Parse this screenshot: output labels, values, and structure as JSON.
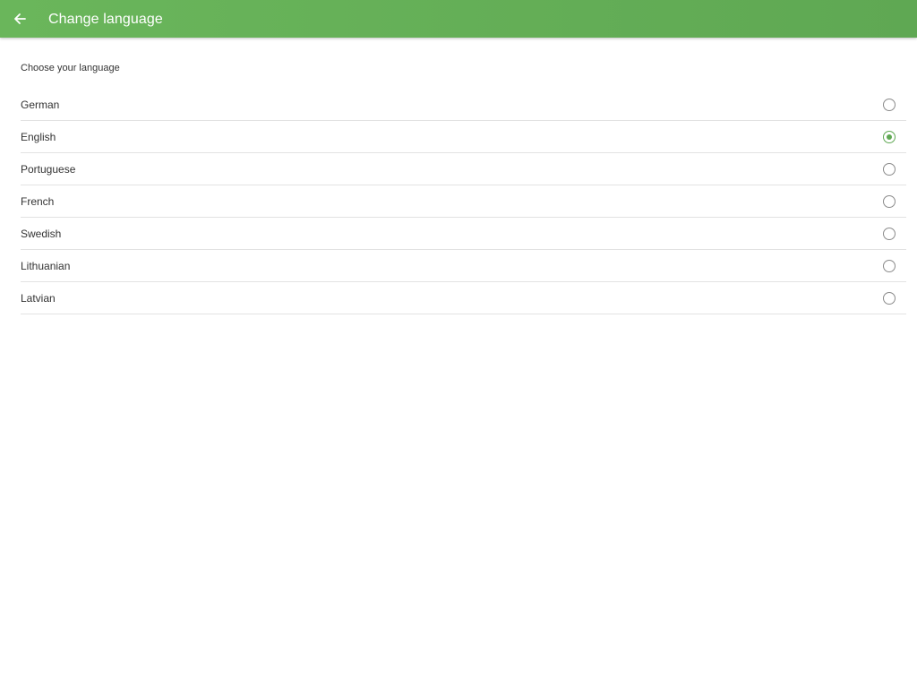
{
  "header": {
    "title": "Change language"
  },
  "section": {
    "label": "Choose your language"
  },
  "languages": [
    {
      "label": "German",
      "selected": false
    },
    {
      "label": "English",
      "selected": true
    },
    {
      "label": "Portuguese",
      "selected": false
    },
    {
      "label": "French",
      "selected": false
    },
    {
      "label": "Swedish",
      "selected": false
    },
    {
      "label": "Lithuanian",
      "selected": false
    },
    {
      "label": "Latvian",
      "selected": false
    }
  ],
  "colors": {
    "app_bar": "#5fa853",
    "accent": "#5fa853",
    "divider": "#e2e2e2"
  },
  "icons": {
    "back": "arrow-left-icon",
    "radio": "radio-button-icon"
  }
}
